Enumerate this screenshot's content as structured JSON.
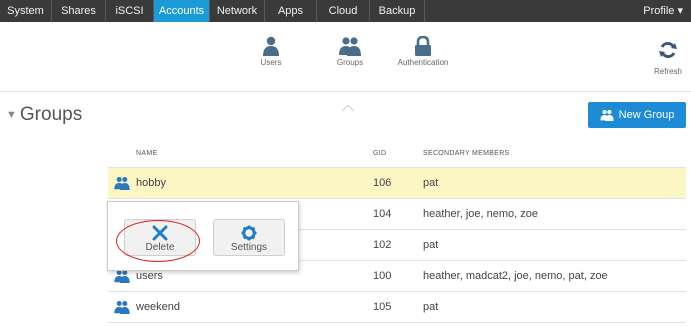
{
  "topnav": {
    "tabs": [
      {
        "label": "System",
        "w": 52
      },
      {
        "label": "Shares",
        "w": 54
      },
      {
        "label": "iSCSI",
        "w": 48
      },
      {
        "label": "Accounts",
        "w": 56,
        "active": true
      },
      {
        "label": "Network",
        "w": 55
      },
      {
        "label": "Apps",
        "w": 52
      },
      {
        "label": "Cloud",
        "w": 53
      },
      {
        "label": "Backup",
        "w": 55
      }
    ],
    "profile": "Profile ▾"
  },
  "subnav": {
    "users": "Users",
    "groups": "Groups",
    "authentication": "Authentication",
    "refresh": "Refresh"
  },
  "header": {
    "title": "Groups",
    "new_group": "New Group"
  },
  "table": {
    "headers": {
      "name": "NAME",
      "gid": "GID",
      "members": "SECONDARY MEMBERS"
    },
    "rows": [
      {
        "name": "hobby",
        "gid": "106",
        "members": "pat",
        "highlight": true
      },
      {
        "name": "",
        "gid": "104",
        "members": "heather, joe, nemo, zoe"
      },
      {
        "name": "",
        "gid": "102",
        "members": "pat"
      },
      {
        "name": "users",
        "gid": "100",
        "members": "heather, madcat2, joe, nemo, pat, zoe"
      },
      {
        "name": "weekend",
        "gid": "105",
        "members": "pat"
      }
    ]
  },
  "popup": {
    "delete": "Delete",
    "settings": "Settings"
  },
  "colors": {
    "accent": "#1a9ad6",
    "button": "#1e8bd6",
    "highlight": "#fbf6c3",
    "ring": "#d8201c"
  }
}
